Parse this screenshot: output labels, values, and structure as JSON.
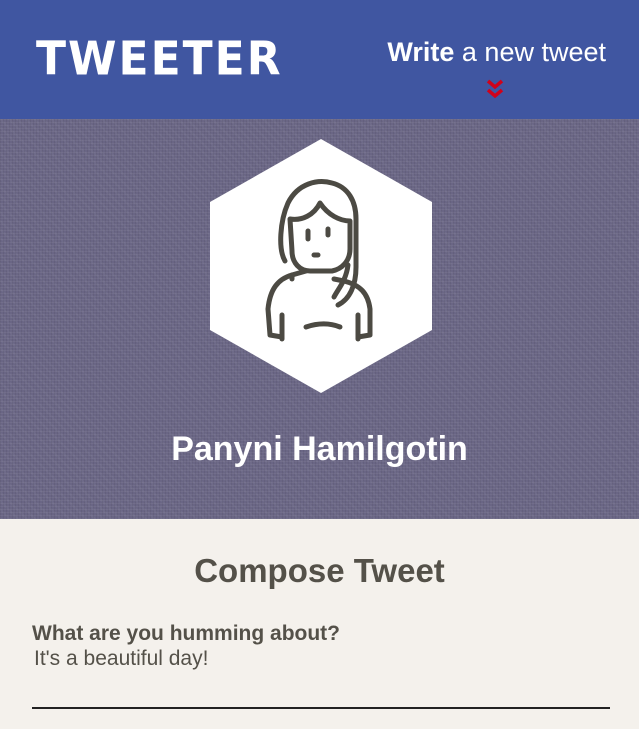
{
  "nav": {
    "logo": "TWEETER",
    "write_strong": "Write",
    "write_rest": " a new tweet",
    "chevron_color": "#d0021b",
    "background": "#4056a1"
  },
  "profile": {
    "name": "Panyni Hamilgotin",
    "avatar_icon": "person-avatar-icon"
  },
  "compose": {
    "title": "Compose Tweet",
    "label": "What are you humming about?",
    "placeholder": "It's a beautiful day!"
  }
}
